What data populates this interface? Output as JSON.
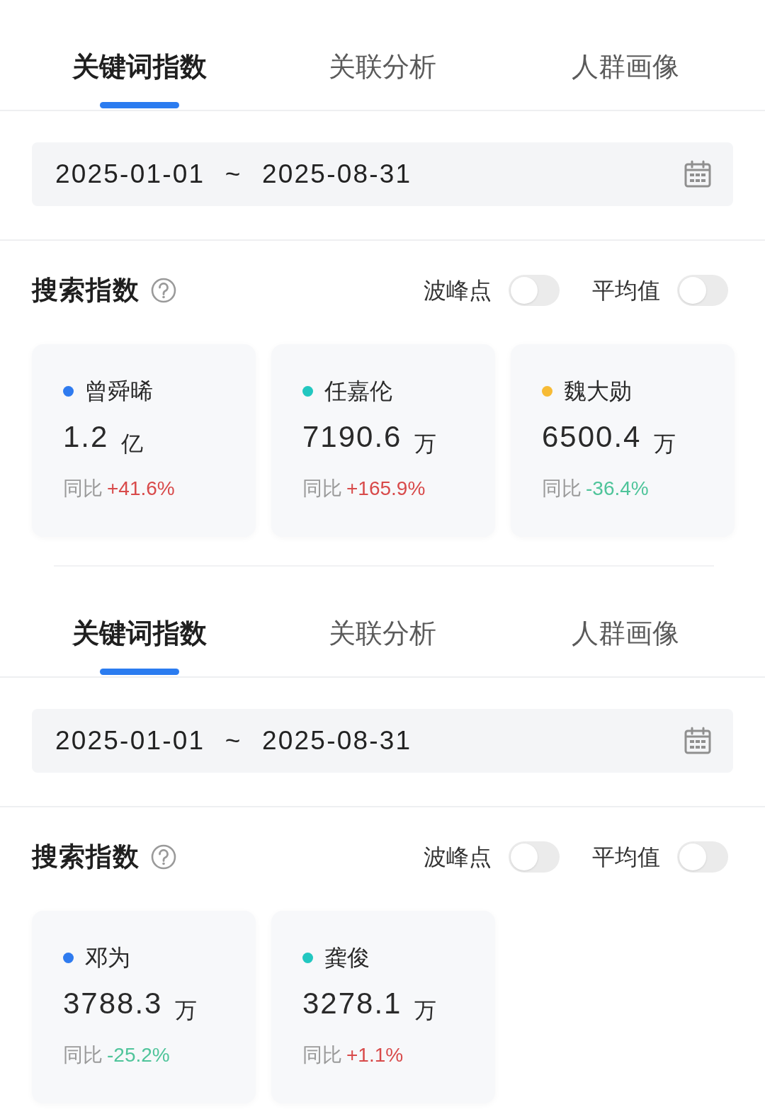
{
  "panels": [
    {
      "tabs": [
        {
          "label": "关键词指数",
          "selected": true
        },
        {
          "label": "关联分析",
          "selected": false
        },
        {
          "label": "人群画像",
          "selected": false
        }
      ],
      "date_range": {
        "value": "2025-01-01 ~ 2025-08-31"
      },
      "section": {
        "title": "搜索指数",
        "toggles": [
          {
            "label": "波峰点",
            "on": false
          },
          {
            "label": "平均值",
            "on": false
          }
        ]
      },
      "cards": [
        {
          "name": "曾舜晞",
          "color": "#2f7bef",
          "value": "1.2",
          "unit": "亿",
          "change_label": "同比",
          "change": "+41.6%",
          "kind": "rise"
        },
        {
          "name": "任嘉伦",
          "color": "#22c7c0",
          "value": "7190.6",
          "unit": "万",
          "change_label": "同比",
          "change": "+165.9%",
          "kind": "rise"
        },
        {
          "name": "魏大勋",
          "color": "#f7bb35",
          "value": "6500.4",
          "unit": "万",
          "change_label": "同比",
          "change": "-36.4%",
          "kind": "fall"
        }
      ]
    },
    {
      "tabs": [
        {
          "label": "关键词指数",
          "selected": true
        },
        {
          "label": "关联分析",
          "selected": false
        },
        {
          "label": "人群画像",
          "selected": false
        }
      ],
      "date_range": {
        "value": "2025-01-01 ~ 2025-08-31"
      },
      "section": {
        "title": "搜索指数",
        "toggles": [
          {
            "label": "波峰点",
            "on": false
          },
          {
            "label": "平均值",
            "on": false
          }
        ]
      },
      "cards": [
        {
          "name": "邓为",
          "color": "#2f7bef",
          "value": "3788.3",
          "unit": "万",
          "change_label": "同比",
          "change": "-25.2%",
          "kind": "fall"
        },
        {
          "name": "龚俊",
          "color": "#22c7c0",
          "value": "3278.1",
          "unit": "万",
          "change_label": "同比",
          "change": "+1.1%",
          "kind": "rise"
        }
      ]
    }
  ]
}
